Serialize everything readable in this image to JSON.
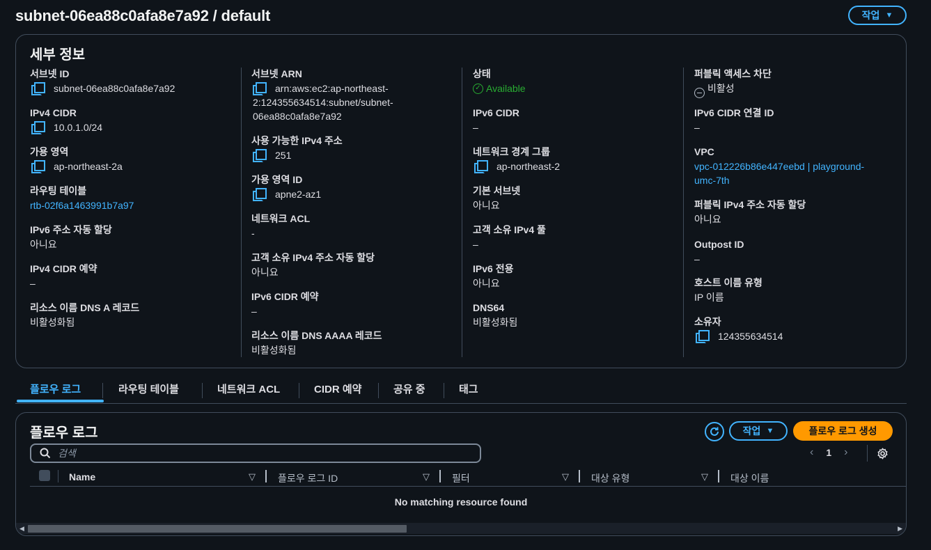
{
  "header": {
    "title": "subnet-06ea88c0afa8e7a92 / default",
    "action_label": "작업"
  },
  "details": {
    "title": "세부 정보",
    "col1": [
      {
        "label": "서브넷 ID",
        "value": "subnet-06ea88c0afa8e7a92"
      },
      {
        "label": "IPv4 CIDR",
        "value": "10.0.1.0/24"
      },
      {
        "label": "가용 영역",
        "value": "ap-northeast-2a"
      },
      {
        "label": "라우팅 테이블",
        "value": "rtb-02f6a1463991b7a97"
      },
      {
        "label": "IPv6 주소 자동 할당",
        "value": "아니요"
      },
      {
        "label": "IPv4 CIDR 예약",
        "value": "–"
      },
      {
        "label": "리소스 이름 DNS A 레코드",
        "value": "비활성화됨"
      }
    ],
    "col2": [
      {
        "label": "서브넷 ARN",
        "value_lines": [
          "arn:aws:ec2:ap-northeast-",
          "2:124355634514:subnet/subnet-",
          "06ea88c0afa8e7a92"
        ]
      },
      {
        "label": "사용 가능한 IPv4 주소",
        "value": "251"
      },
      {
        "label": "가용 영역 ID",
        "value": "apne2-az1"
      },
      {
        "label": "네트워크 ACL",
        "value": "-"
      },
      {
        "label": "고객 소유 IPv4 주소 자동 할당",
        "value": "아니요"
      },
      {
        "label": "IPv6 CIDR 예약",
        "value": "–"
      },
      {
        "label": "리소스 이름 DNS AAAA 레코드",
        "value": "비활성화됨"
      }
    ],
    "col3": [
      {
        "label": "상태",
        "value": "Available"
      },
      {
        "label": "IPv6 CIDR",
        "value": "–"
      },
      {
        "label": "네트워크 경계 그룹",
        "value": "ap-northeast-2"
      },
      {
        "label": "기본 서브넷",
        "value": "아니요"
      },
      {
        "label": "고객 소유 IPv4 풀",
        "value": "–"
      },
      {
        "label": "IPv6 전용",
        "value": "아니요"
      },
      {
        "label": "DNS64",
        "value": "비활성화됨"
      }
    ],
    "col4": [
      {
        "label": "퍼블릭 액세스 차단",
        "value": "비활성"
      },
      {
        "label": "IPv6 CIDR 연결 ID",
        "value": "–"
      },
      {
        "label": "VPC",
        "value_lines": [
          "vpc-012226b86e447eebd | playground-",
          "umc-7th"
        ]
      },
      {
        "label": "퍼블릭 IPv4 주소 자동 할당",
        "value": "아니요"
      },
      {
        "label": "Outpost ID",
        "value": "–"
      },
      {
        "label": "호스트 이름 유형",
        "value": "IP 이름"
      },
      {
        "label": "소유자",
        "value": "124355634514"
      }
    ]
  },
  "tabs": [
    "플로우 로그",
    "라우팅 테이블",
    "네트워크 ACL",
    "CIDR 예약",
    "공유 중",
    "태그"
  ],
  "flow_logs": {
    "title": "플로우 로그",
    "action_label": "작업",
    "create_label": "플로우 로그 생성",
    "search_placeholder": "검색",
    "page": "1",
    "columns": [
      "Name",
      "플로우 로그 ID",
      "필터",
      "대상 유형",
      "대상 이름"
    ],
    "empty_text": "No matching resource found"
  },
  "colors": {
    "accent": "#42b4ff",
    "primary": "#ff9900",
    "success": "#29ad32",
    "background": "#0f141a",
    "border": "#414d5c"
  }
}
